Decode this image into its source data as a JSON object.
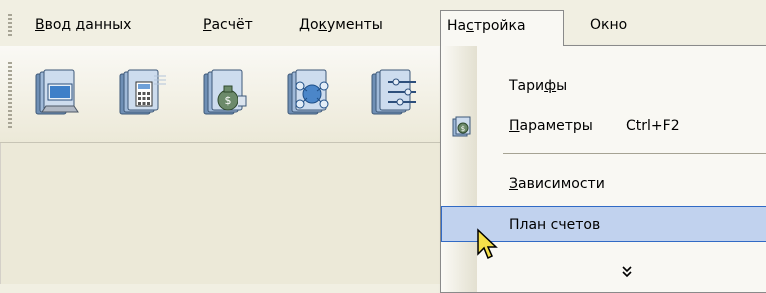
{
  "menubar": {
    "items": [
      {
        "label_pre": "",
        "label_mn": "В",
        "label_post": "вод данных"
      },
      {
        "label_pre": "",
        "label_mn": "Р",
        "label_post": "асчёт"
      },
      {
        "label_pre": "До",
        "label_mn": "к",
        "label_post": "ументы"
      },
      {
        "label_pre": "На",
        "label_mn": "с",
        "label_post": "тройка"
      },
      {
        "label_pre": "Окно",
        "label_mn": "",
        "label_post": ""
      }
    ],
    "active_index": 3
  },
  "toolbar": {
    "buttons": [
      {
        "icon": "computer-folder-icon"
      },
      {
        "icon": "calculator-folder-icon"
      },
      {
        "icon": "money-bag-folder-icon"
      },
      {
        "icon": "network-folder-icon"
      },
      {
        "icon": "settings-folder-icon"
      }
    ]
  },
  "dropdown": {
    "items": [
      {
        "label_pre": "Тари",
        "label_mn": "ф",
        "label_post": "ы",
        "shortcut": ""
      },
      {
        "label_pre": "",
        "label_mn": "П",
        "label_post": "араметры",
        "shortcut": "Ctrl+F2",
        "icon": "money-bag-folder-icon"
      },
      {
        "label_pre": "",
        "label_mn": "З",
        "label_post": "ависимости",
        "shortcut": ""
      },
      {
        "label_pre": "План счетов",
        "label_mn": "",
        "label_post": "",
        "shortcut": "",
        "hovered": true
      }
    ],
    "expand_glyph": "»",
    "expand_icon": "chevron-double-down-icon"
  },
  "colors": {
    "menu_background": "#f1efe2",
    "dropdown_background": "#f9f8f3",
    "hover_fill": "#c1d2ee",
    "hover_border": "#316ac5"
  },
  "cursor": {
    "icon": "arrow-cursor-icon"
  }
}
